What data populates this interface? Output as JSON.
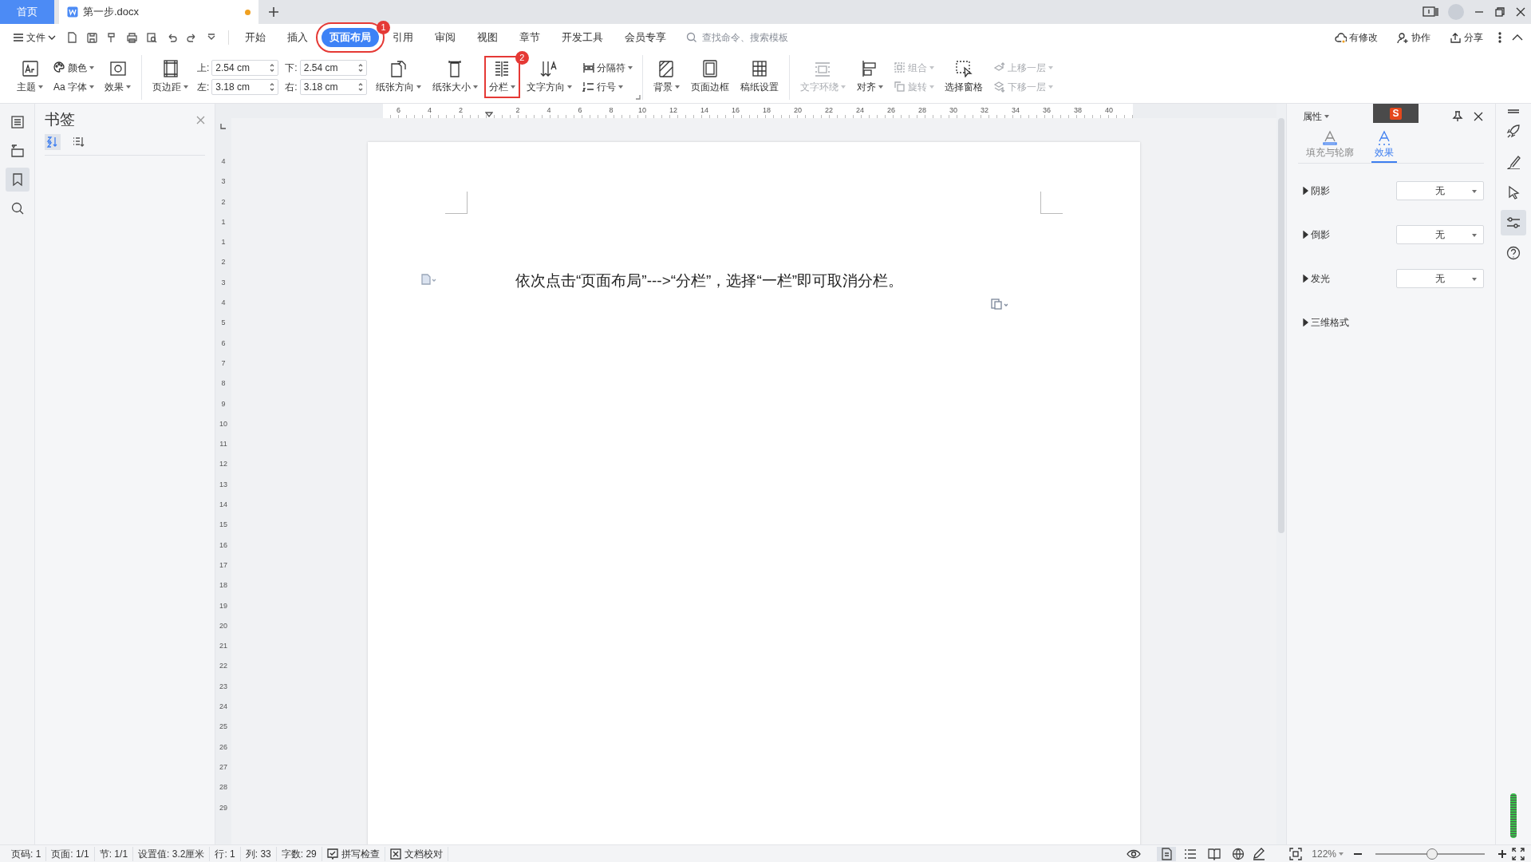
{
  "title_bar": {
    "tabs": [
      {
        "label": "首页",
        "kind": "home",
        "selected": false
      },
      {
        "label": "第一步.docx",
        "kind": "document",
        "selected": true,
        "modified": true
      }
    ]
  },
  "menu_bar": {
    "file_menu": "文件",
    "tabs": [
      {
        "label": "开始",
        "selected": false
      },
      {
        "label": "插入",
        "selected": false
      },
      {
        "label": "页面布局",
        "selected": true,
        "highlighted": true,
        "callout": "1"
      },
      {
        "label": "引用",
        "selected": false
      },
      {
        "label": "审阅",
        "selected": false
      },
      {
        "label": "视图",
        "selected": false
      },
      {
        "label": "章节",
        "selected": false
      },
      {
        "label": "开发工具",
        "selected": false
      },
      {
        "label": "会员专享",
        "selected": false
      }
    ],
    "search": {
      "placeholder": "查找命令、搜索模板"
    },
    "actions": [
      "有修改",
      "协作",
      "分享"
    ]
  },
  "ribbon": {
    "groups": [
      {
        "columns": [
          {
            "items": [
              {
                "kind": "big",
                "label": "主题",
                "dropdown": true,
                "disabled": false
              }
            ]
          },
          {
            "items": [
              {
                "kind": "small",
                "label": "颜色",
                "dropdown": true,
                "disabled": false
              },
              {
                "kind": "small",
                "label": "Aa 字体",
                "dropdown": true,
                "disabled": false
              }
            ]
          },
          {
            "items": [
              {
                "kind": "big",
                "label": "效果",
                "dropdown": true,
                "disabled": false
              }
            ]
          }
        ]
      },
      {
        "columns": [
          {
            "items": [
              {
                "kind": "big",
                "label": "页边距",
                "dropdown": true,
                "disabled": false
              }
            ]
          },
          {
            "items": [
              {
                "kind": "field",
                "label": "上:",
                "value": "2.54 cm"
              },
              {
                "kind": "field",
                "label": "左:",
                "value": "3.18 cm"
              }
            ]
          },
          {
            "items": [
              {
                "kind": "field",
                "label": "下:",
                "value": "2.54 cm"
              },
              {
                "kind": "field",
                "label": "右:",
                "value": "3.18 cm"
              }
            ]
          },
          {
            "items": [
              {
                "kind": "big",
                "label": "纸张方向",
                "dropdown": true,
                "disabled": false
              }
            ]
          },
          {
            "items": [
              {
                "kind": "big",
                "label": "纸张大小",
                "dropdown": true,
                "disabled": false
              }
            ]
          },
          {
            "items": [
              {
                "kind": "big",
                "label": "分栏",
                "dropdown": true,
                "disabled": false,
                "highlighted": true,
                "callout": "2"
              }
            ]
          },
          {
            "items": [
              {
                "kind": "big",
                "label": "文字方向",
                "dropdown": true,
                "disabled": false
              }
            ]
          },
          {
            "items": [
              {
                "kind": "small",
                "label": "分隔符",
                "dropdown": true,
                "disabled": false
              },
              {
                "kind": "small",
                "label": "行号",
                "dropdown": true,
                "disabled": false
              }
            ]
          }
        ]
      },
      {
        "columns": [
          {
            "items": [
              {
                "kind": "big",
                "label": "背景",
                "dropdown": true,
                "disabled": false
              }
            ]
          },
          {
            "items": [
              {
                "kind": "big",
                "label": "页面边框",
                "dropdown": false,
                "disabled": false
              }
            ]
          },
          {
            "items": [
              {
                "kind": "big",
                "label": "稿纸设置",
                "dropdown": false,
                "disabled": false
              }
            ]
          }
        ]
      },
      {
        "columns": [
          {
            "items": [
              {
                "kind": "big",
                "label": "文字环绕",
                "dropdown": true,
                "disabled": true
              }
            ]
          },
          {
            "items": [
              {
                "kind": "big",
                "label": "对齐",
                "dropdown": true,
                "disabled": false
              }
            ]
          },
          {
            "items": [
              {
                "kind": "small",
                "label": "组合",
                "dropdown": true,
                "disabled": true
              },
              {
                "kind": "small",
                "label": "旋转",
                "dropdown": true,
                "disabled": true
              }
            ]
          },
          {
            "items": [
              {
                "kind": "big",
                "label": "选择窗格",
                "dropdown": false,
                "disabled": false
              }
            ]
          },
          {
            "items": [
              {
                "kind": "small",
                "label": "上移一层",
                "dropdown": true,
                "disabled": true
              },
              {
                "kind": "small",
                "label": "下移一层",
                "dropdown": true,
                "disabled": true
              }
            ]
          }
        ]
      }
    ]
  },
  "nav_icons": [
    {
      "selected": false
    },
    {
      "selected": false
    },
    {
      "selected": true
    },
    {
      "selected": false
    }
  ],
  "bookmark_panel": {
    "title": "书签",
    "sort_buttons": [
      {
        "selected": true
      },
      {
        "selected": false
      }
    ]
  },
  "rulers": {
    "horizontal": [
      "6",
      "4",
      "2",
      "2",
      "4",
      "6",
      "8",
      "10",
      "12",
      "14",
      "16",
      "18",
      "20",
      "22",
      "24",
      "26",
      "28",
      "30",
      "32",
      "34",
      "36",
      "38",
      "40"
    ],
    "vertical": [
      "4",
      "3",
      "2",
      "1",
      "1",
      "2",
      "3",
      "4",
      "5",
      "6",
      "7",
      "8",
      "9",
      "10",
      "11",
      "12",
      "13",
      "14",
      "15",
      "16",
      "17",
      "18",
      "19",
      "20",
      "21",
      "22",
      "23",
      "24",
      "25",
      "26",
      "27",
      "28",
      "29"
    ]
  },
  "document": {
    "text": "依次点击“页面布局”--->“分栏”，选择“一栏”即可取消分栏。"
  },
  "properties_panel": {
    "title": "属性",
    "ime_logo": "S",
    "tabs": [
      {
        "label": "填充与轮廓",
        "selected": false
      },
      {
        "label": "效果",
        "selected": true
      }
    ],
    "sections": [
      {
        "label": "阴影",
        "value": "无"
      },
      {
        "label": "倒影",
        "value": "无"
      },
      {
        "label": "发光",
        "value": "无"
      },
      {
        "label": "三维格式"
      }
    ]
  },
  "tool_strip": [
    {
      "selected": false
    },
    {
      "selected": false
    },
    {
      "selected": false
    },
    {
      "selected": true
    },
    {
      "selected": false
    }
  ],
  "status_bar": {
    "items": [
      {
        "kind": "text",
        "text": "页码: 1"
      },
      {
        "kind": "text",
        "text": "页面: 1/1"
      },
      {
        "kind": "text",
        "text": "节: 1/1"
      },
      {
        "kind": "text",
        "text": "设置值: 3.2厘米"
      },
      {
        "kind": "text",
        "text": "行: 1"
      },
      {
        "kind": "text",
        "text": "列: 33"
      },
      {
        "kind": "text",
        "text": "字数: 29"
      },
      {
        "kind": "spell",
        "text": "拼写检查"
      },
      {
        "kind": "proof",
        "text": "文档校对"
      }
    ],
    "views": [
      {
        "selected": true
      },
      {
        "selected": false
      },
      {
        "selected": false
      },
      {
        "selected": false
      }
    ],
    "zoom": "122%",
    "zoom_slider": {
      "level": 0.52
    }
  }
}
